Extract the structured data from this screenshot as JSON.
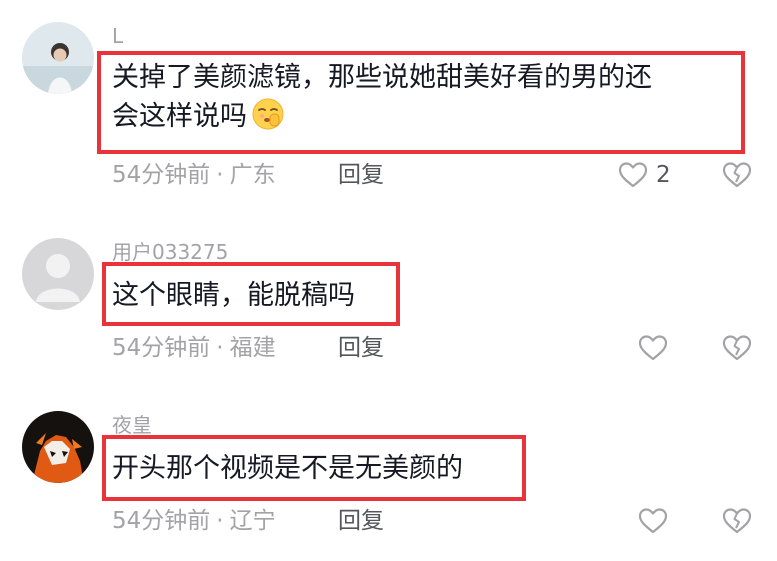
{
  "comments": [
    {
      "username": "L",
      "text_line1": "关掉了美颜滤镜，那些说她甜美好看的男的还",
      "text_line2": "会这样说吗",
      "emoji": "smirk-shh-emoji",
      "time": "54分钟前",
      "location": "广东",
      "reply_label": "回复",
      "likes": "2"
    },
    {
      "username": "用户033275",
      "text_line1": "这个眼睛，能脱稿吗",
      "time": "54分钟前",
      "location": "福建",
      "reply_label": "回复",
      "likes": ""
    },
    {
      "username": "夜皇",
      "text_line1": "开头那个视频是不是无美颜的",
      "time": "54分钟前",
      "location": "辽宁",
      "reply_label": "回复",
      "likes": ""
    }
  ],
  "separator": "·",
  "colors": {
    "highlight": "#e8333b",
    "meta_gray": "#a3a3a7",
    "text": "#161823"
  },
  "icons": {
    "like": "heart-outline-icon",
    "dislike": "broken-heart-icon"
  }
}
